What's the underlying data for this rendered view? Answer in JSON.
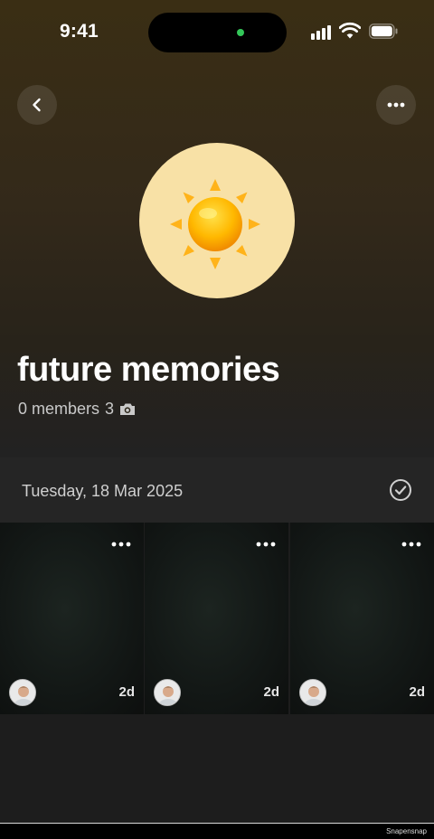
{
  "status": {
    "time": "9:41",
    "icons": [
      "signal-icon",
      "wifi-icon",
      "battery-icon"
    ]
  },
  "header": {
    "back_icon": "chevron-left-icon",
    "more_icon": "more-horizontal-icon"
  },
  "group": {
    "emoji": "sun-icon",
    "title": "future memories",
    "members_text": "0 members",
    "photo_count": "3",
    "photo_icon": "camera-icon",
    "avatar_bg": "#f8e1a6"
  },
  "date_section": {
    "date": "Tuesday, 18 Mar 2025",
    "select_icon": "check-circle-icon"
  },
  "tiles": [
    {
      "age": "2d",
      "more_icon": "more-horizontal-icon",
      "avatar": "user-avatar"
    },
    {
      "age": "2d",
      "more_icon": "more-horizontal-icon",
      "avatar": "user-avatar"
    },
    {
      "age": "2d",
      "more_icon": "more-horizontal-icon",
      "avatar": "user-avatar"
    }
  ],
  "footer": {
    "watermark": "Snapensnap"
  }
}
